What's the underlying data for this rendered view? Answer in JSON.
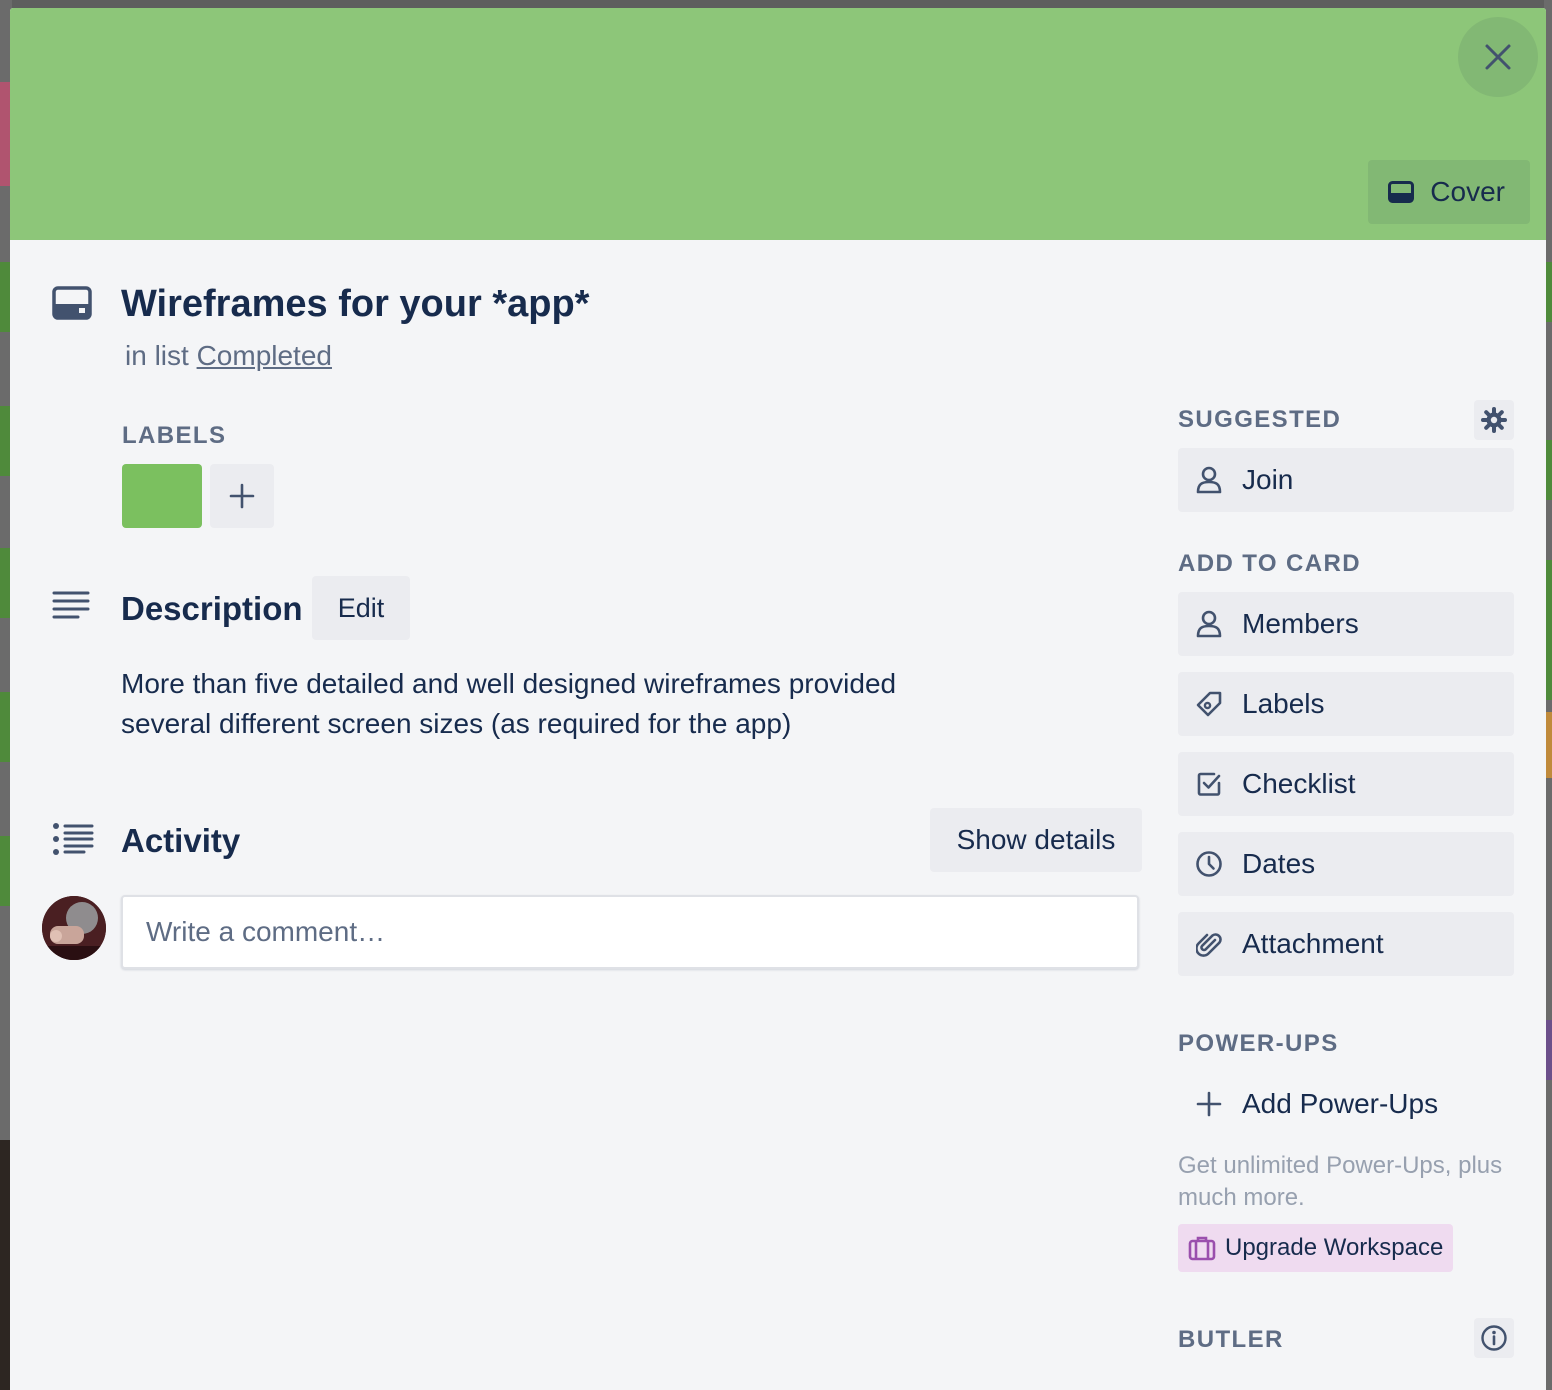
{
  "colors": {
    "cover": "#8dc679",
    "label_green": "#7bc05f",
    "text_dark": "#172b4d",
    "text_muted": "#5e6c84",
    "button_bg": "#ebecf0",
    "upgrade_bg": "#efdbf0",
    "upgrade_icon": "#9a4fad"
  },
  "cover": {
    "button_label": "Cover",
    "close_icon": "close-icon"
  },
  "card": {
    "title": "Wireframes for your *app*",
    "list_prefix": "in list",
    "list_name": "Completed"
  },
  "labels": {
    "heading": "LABELS",
    "items": [
      {
        "color": "#7bc05f"
      }
    ]
  },
  "description": {
    "heading": "Description",
    "edit_label": "Edit",
    "text": "More than five detailed and well designed wireframes provided several different screen sizes (as required for the app)"
  },
  "activity": {
    "heading": "Activity",
    "show_details_label": "Show details",
    "comment_placeholder": "Write a comment…"
  },
  "sidebar": {
    "suggested_heading": "SUGGESTED",
    "join_label": "Join",
    "add_to_card_heading": "ADD TO CARD",
    "add_to_card": [
      {
        "label": "Members",
        "icon": "person-icon"
      },
      {
        "label": "Labels",
        "icon": "tag-icon"
      },
      {
        "label": "Checklist",
        "icon": "checklist-icon"
      },
      {
        "label": "Dates",
        "icon": "clock-icon"
      },
      {
        "label": "Attachment",
        "icon": "paperclip-icon"
      }
    ],
    "powerups_heading": "POWER-UPS",
    "add_powerups_label": "Add Power-Ups",
    "powerups_note": "Get unlimited Power-Ups, plus much more.",
    "upgrade_label": "Upgrade Workspace",
    "butler_heading": "BUTLER"
  }
}
